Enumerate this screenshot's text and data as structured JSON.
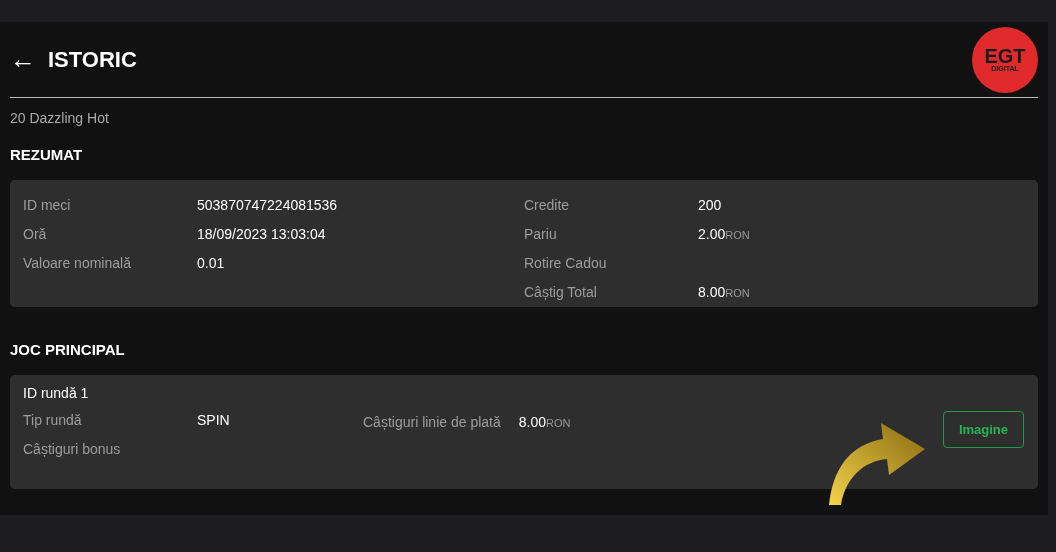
{
  "header": {
    "back_icon": "←",
    "title": "ISTORIC",
    "logo": {
      "text": "EGT",
      "subtext": "DIGITAL"
    }
  },
  "game_name": "20 Dazzling Hot",
  "summary": {
    "title": "REZUMAT",
    "left": [
      {
        "label": "ID meci",
        "value": "503870747224081536"
      },
      {
        "label": "Oră",
        "value": "18/09/2023 13:03:04"
      },
      {
        "label": "Valoare nominală",
        "value": "0.01"
      }
    ],
    "right": [
      {
        "label": "Credite",
        "value": "200"
      },
      {
        "label": "Pariu",
        "value": "2.00",
        "unit": "RON"
      },
      {
        "label": "Rotire Cadou"
      },
      {
        "label": "Câștig Total",
        "value": "8.00",
        "unit": "RON"
      }
    ]
  },
  "main_game": {
    "title": "JOC PRINCIPAL",
    "rounds": [
      {
        "title": "ID rundă 1",
        "rows": [
          {
            "label": "Tip rundă",
            "value": "SPIN"
          },
          {
            "label": "Câștiguri bonus"
          }
        ],
        "payline": {
          "label": "Câștiguri linie de plată",
          "value": "8.00",
          "unit": "RON"
        },
        "button": "Imagine"
      }
    ]
  }
}
